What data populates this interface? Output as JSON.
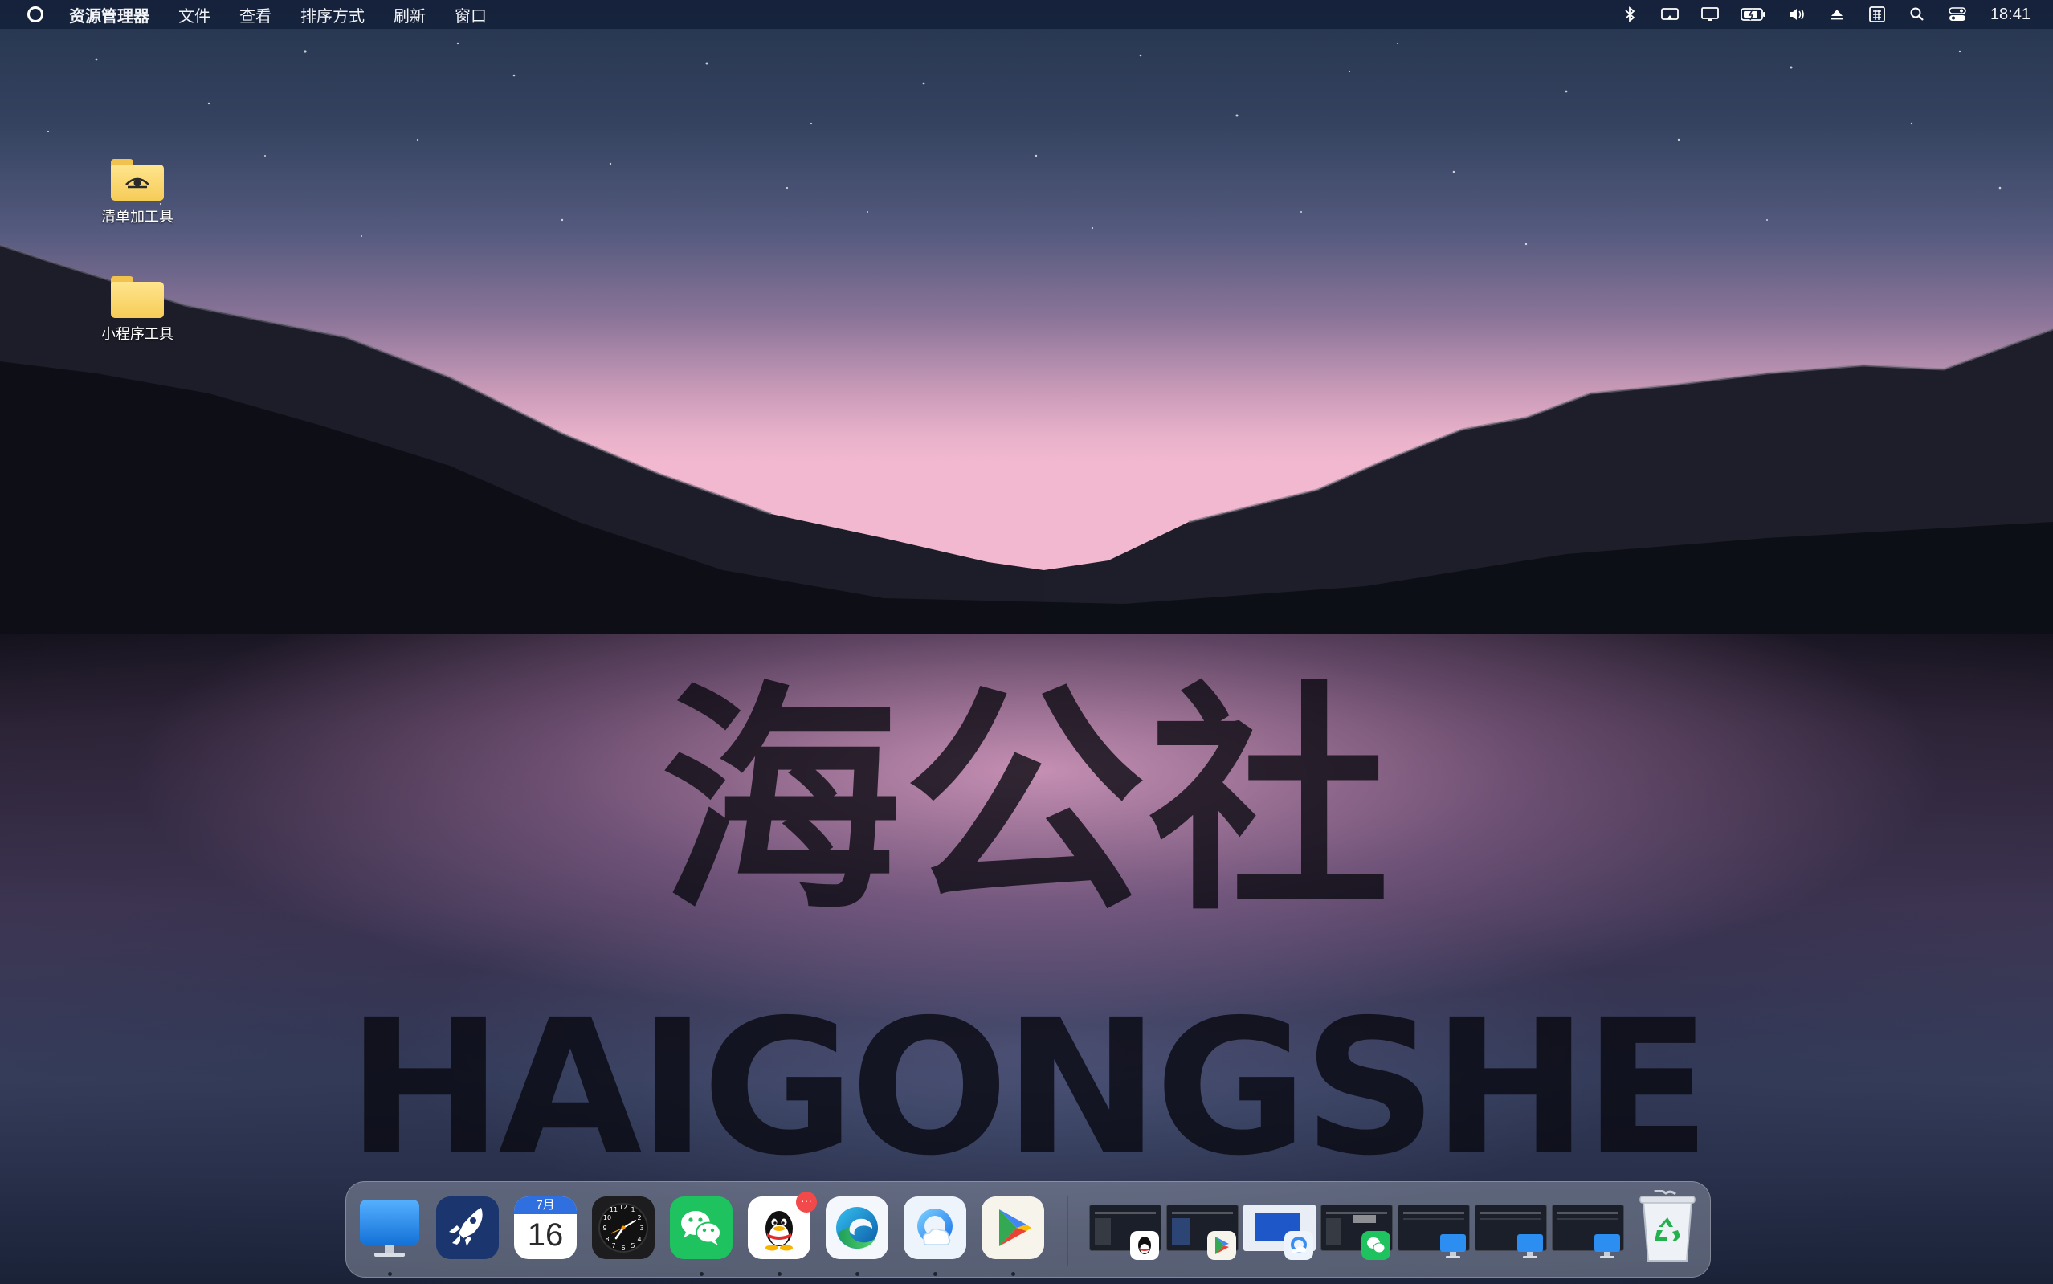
{
  "menubar": {
    "app_name": "资源管理器",
    "items": [
      "文件",
      "查看",
      "排序方式",
      "刷新",
      "窗口"
    ],
    "tray_icons": [
      "bluetooth-icon",
      "cast-icon",
      "display-icon",
      "battery-charging-icon",
      "volume-icon",
      "eject-icon",
      "input-method-icon",
      "search-icon",
      "control-center-icon"
    ],
    "time": "18:41"
  },
  "desktop": {
    "icons": [
      {
        "label": "清单加工具",
        "icon": "folder-eye-icon"
      },
      {
        "label": "小程序工具",
        "icon": "folder-icon"
      }
    ]
  },
  "wallpaper": {
    "title_cn": "海公社",
    "title_en": "HAIGONGSHE"
  },
  "dock": {
    "apps": [
      {
        "name": "finder",
        "icon": "monitor-icon",
        "running": true
      },
      {
        "name": "launchpad",
        "icon": "rocket-icon",
        "running": false
      },
      {
        "name": "calendar",
        "icon": "calendar-icon",
        "running": false,
        "month": "7月",
        "day": "16"
      },
      {
        "name": "clock",
        "icon": "clock-icon",
        "running": false
      },
      {
        "name": "wechat",
        "icon": "wechat-icon",
        "running": true
      },
      {
        "name": "qq",
        "icon": "qq-penguin-icon",
        "running": true,
        "badge": "···"
      },
      {
        "name": "edge",
        "icon": "edge-icon",
        "running": true
      },
      {
        "name": "cloud-browser",
        "icon": "cloud-search-icon",
        "running": true
      },
      {
        "name": "play-store",
        "icon": "play-triangle-icon",
        "running": true
      }
    ],
    "windows": [
      {
        "name": "qq-window",
        "badge_icon": "qq-penguin-icon"
      },
      {
        "name": "play-store-window",
        "badge_icon": "play-triangle-icon"
      },
      {
        "name": "cloud-browser-window",
        "badge_icon": "cloud-search-icon"
      },
      {
        "name": "wechat-window",
        "badge_icon": "wechat-icon"
      },
      {
        "name": "finder-window-1",
        "badge_icon": "monitor-icon"
      },
      {
        "name": "finder-window-2",
        "badge_icon": "monitor-icon"
      },
      {
        "name": "finder-window-3",
        "badge_icon": "monitor-icon"
      }
    ],
    "trash_icon": "recycle-bin-icon",
    "colors": {
      "finder": "#2b8ef0",
      "launchpad": "#1f3c7a",
      "wechat": "#1ec25f",
      "edge": "#1a8fe0",
      "play": "#34a853"
    }
  }
}
